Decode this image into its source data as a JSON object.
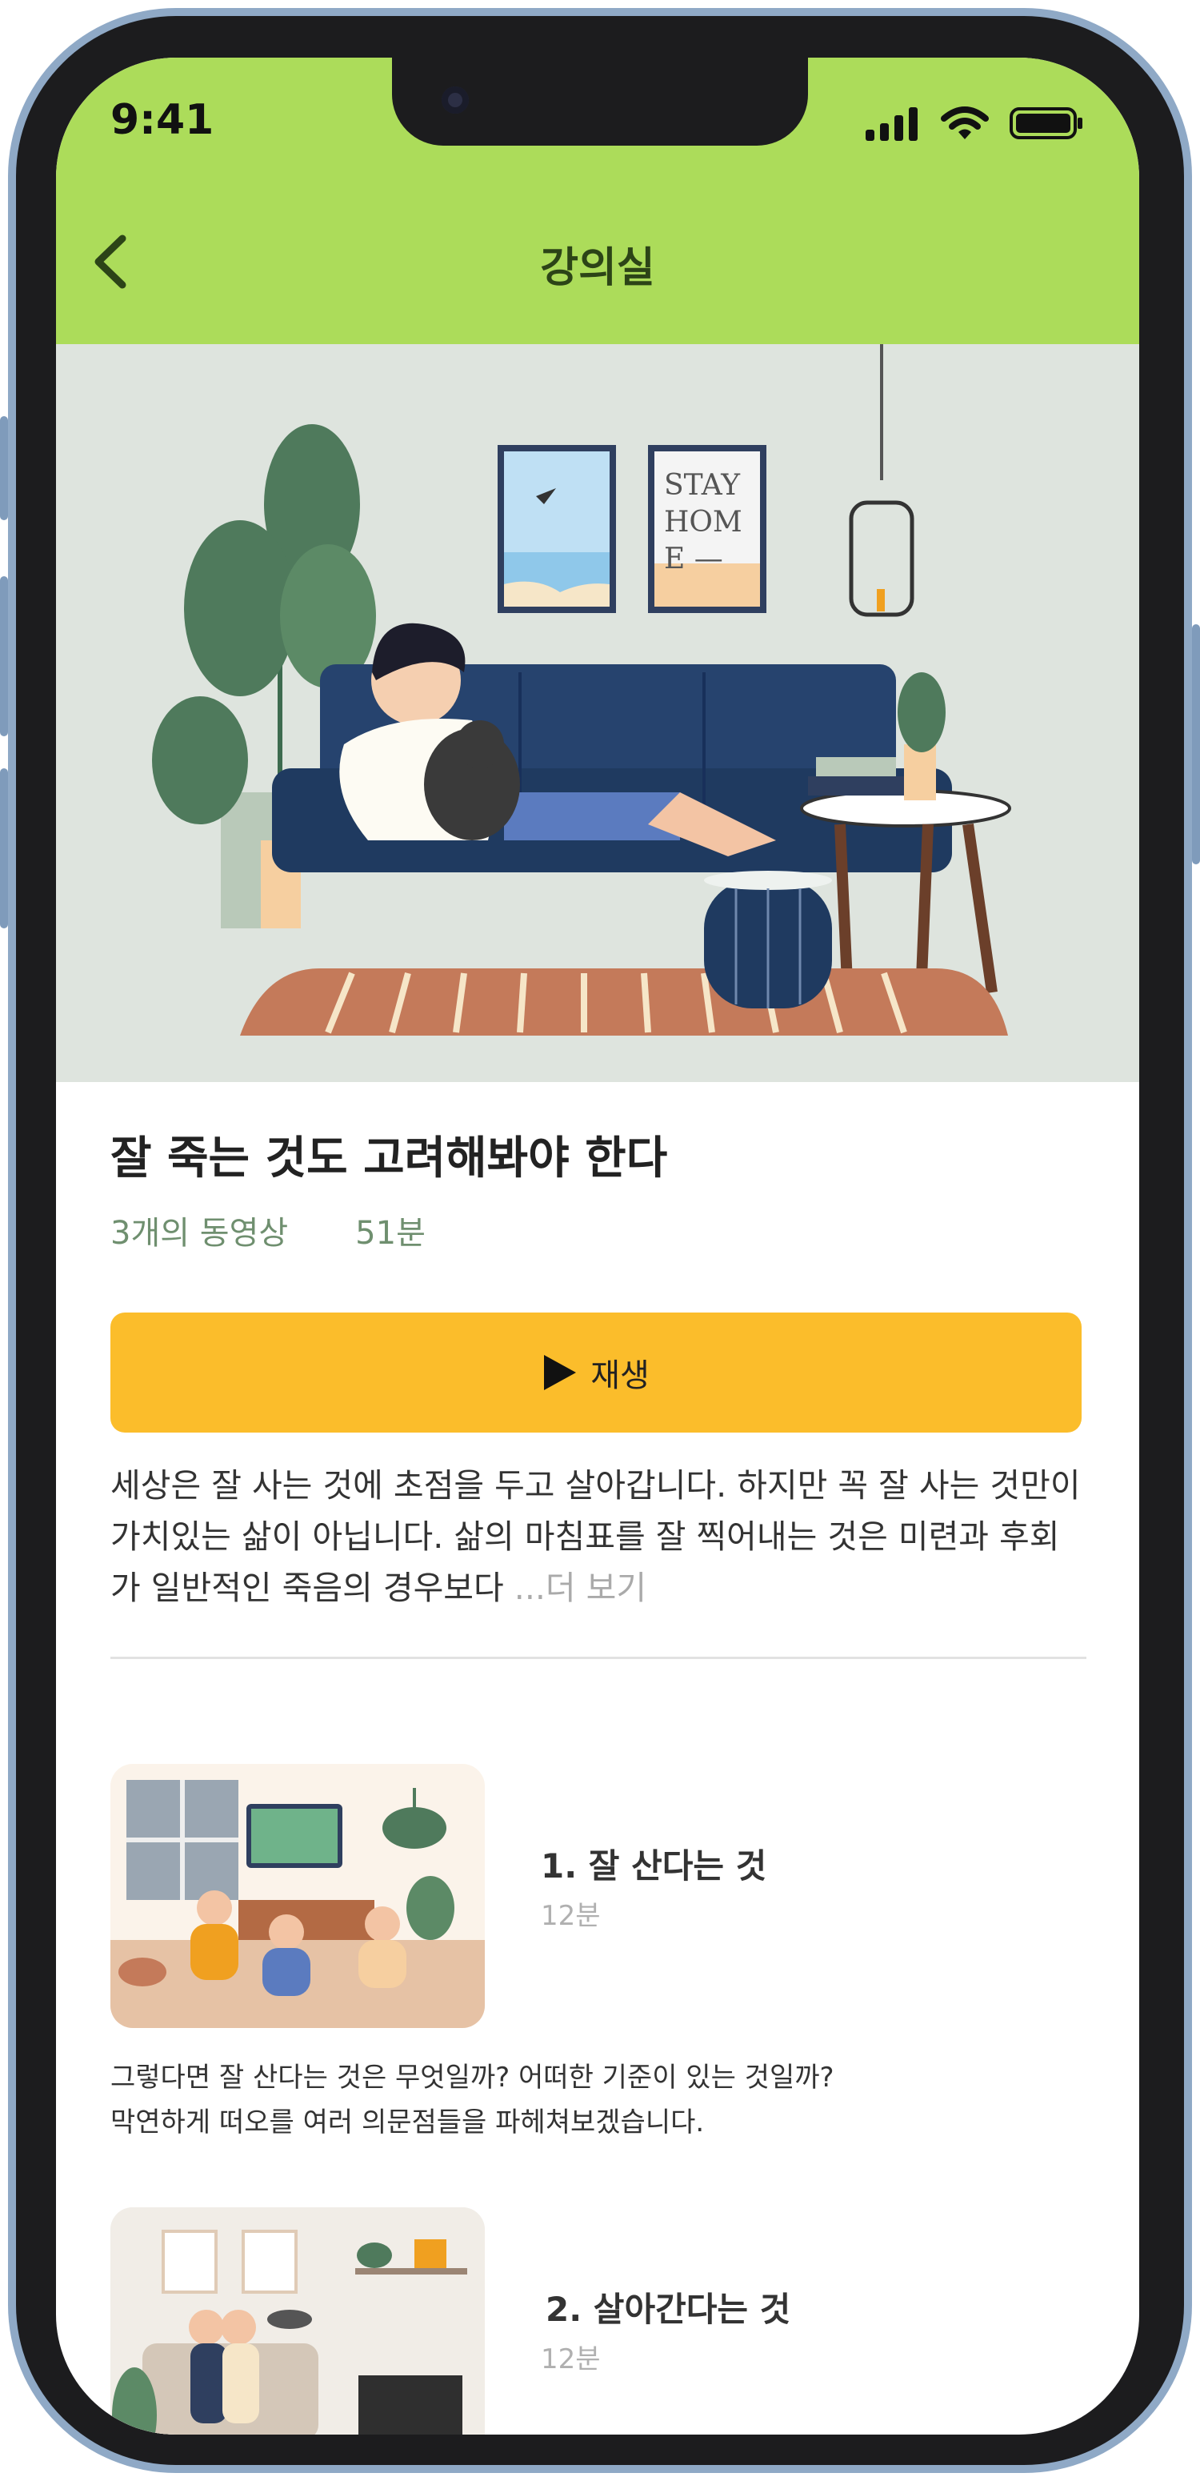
{
  "status_bar": {
    "time": "9:41"
  },
  "header": {
    "title": "강의실"
  },
  "course": {
    "title": "잘 죽는 것도 고려해봐야 한다",
    "video_count": "3개의 동영상",
    "duration": "51분",
    "play_label": "재생",
    "description": "세상은 잘 사는 것에 초점을 두고 살아갑니다. 하지만 꼭 잘 사는 것만이 가치있는 삶이 아닙니다. 삶의 마침표를 잘 찍어내는 것은 미련과 후회가 일반적인 죽음의 경우보다",
    "ellipsis": " ...",
    "more_label": "더 보기"
  },
  "hero_art": {
    "poster_text": [
      "STAY",
      "HOM",
      "E —"
    ]
  },
  "episodes": [
    {
      "title": "1. 잘 산다는 것",
      "duration": "12분",
      "description_line1": "그렇다면 잘 산다는 것은 무엇일까? 어떠한 기준이 있는 것일까?",
      "description_line2": "막연하게 떠오를 여러 의문점들을 파헤쳐보겠습니다."
    },
    {
      "title": "2. 살아간다는 것",
      "duration": "12분"
    }
  ],
  "colors": {
    "header_bg": "#acdc5a",
    "header_text": "#2c4417",
    "play_button": "#fbbd2b",
    "meta_text": "#6f8f6f"
  }
}
